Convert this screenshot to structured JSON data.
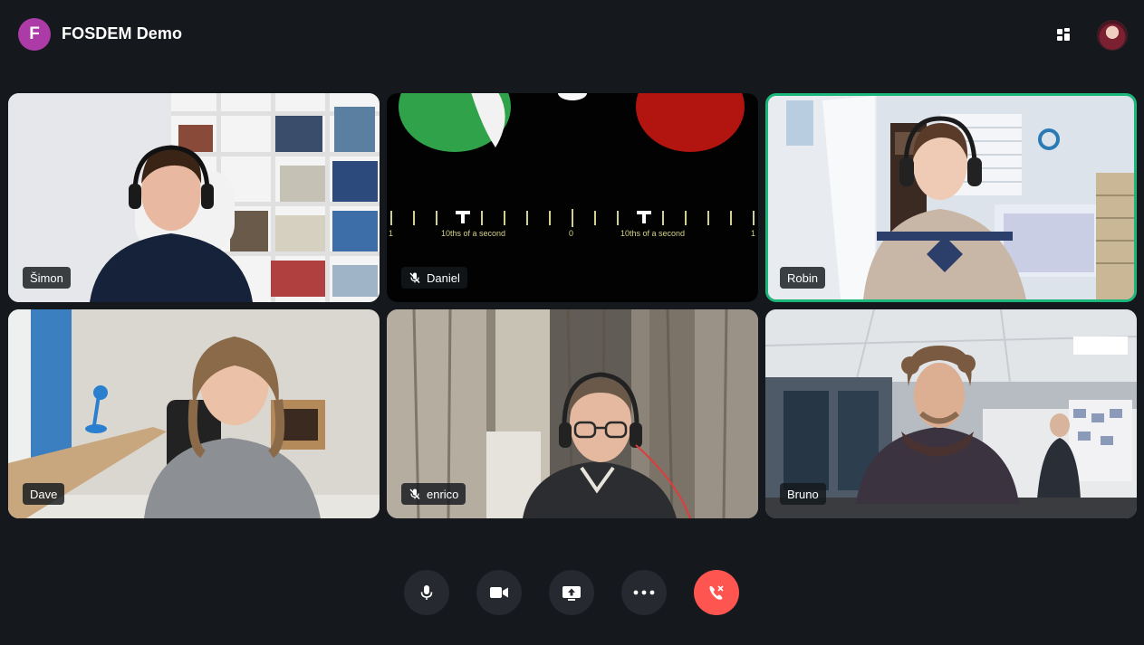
{
  "room": {
    "initial": "F",
    "name": "FOSDEM Demo",
    "avatar_color": "#ac3ba8"
  },
  "header": {
    "layout_icon": "grid-layout-icon",
    "user_avatar": "user-avatar"
  },
  "participants": [
    {
      "name": "Šimon",
      "muted": false,
      "speaking": false
    },
    {
      "name": "Daniel",
      "muted": true,
      "speaking": false
    },
    {
      "name": "Robin",
      "muted": false,
      "speaking": true
    },
    {
      "name": "Dave",
      "muted": false,
      "speaking": false
    },
    {
      "name": "enrico",
      "muted": true,
      "speaking": false
    },
    {
      "name": "Bruno",
      "muted": false,
      "speaking": false
    }
  ],
  "daniel_screen": {
    "left_label": "10ths of a second",
    "center_label": "0",
    "right_label": "10ths of a second",
    "edge_left": "1",
    "edge_right": "1"
  },
  "controls": [
    {
      "icon": "microphone-icon"
    },
    {
      "icon": "camera-icon"
    },
    {
      "icon": "screen-share-icon"
    },
    {
      "icon": "more-options-icon"
    },
    {
      "icon": "hang-up-icon"
    }
  ],
  "colors": {
    "background": "#15191e",
    "control": "#26292f",
    "hangup": "#fe5550",
    "speaking_border": "#1ab67a"
  }
}
